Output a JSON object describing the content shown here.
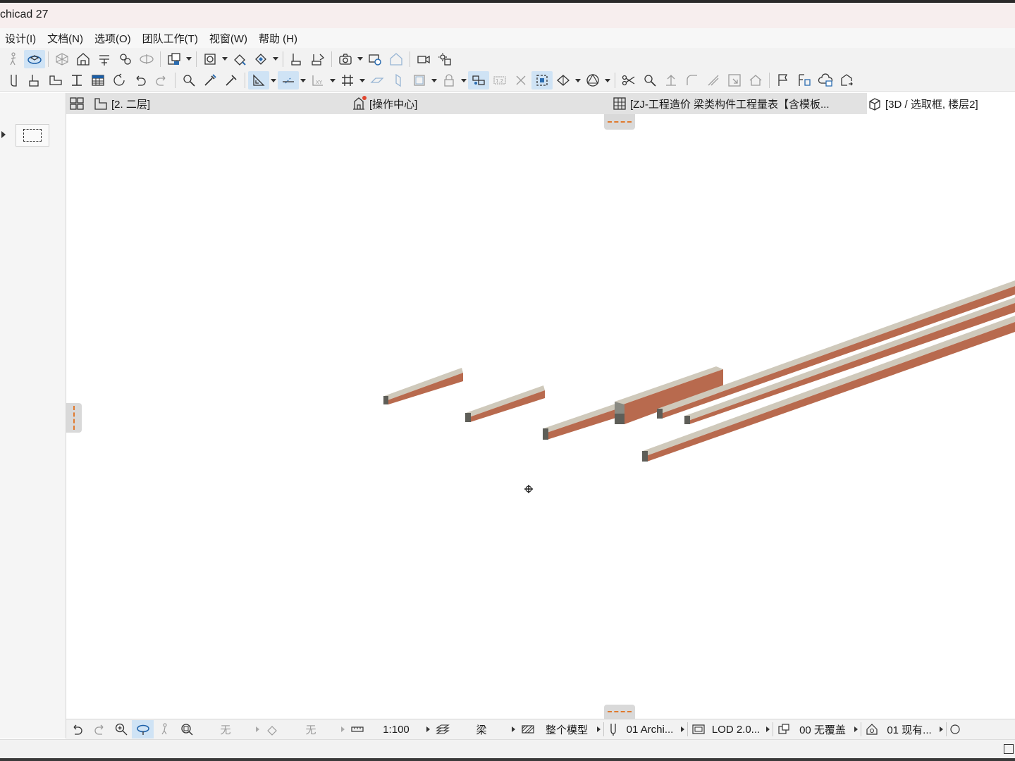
{
  "window": {
    "title": "chicad 27"
  },
  "menu": [
    "设计(I)",
    "文档(N)",
    "选项(O)",
    "团队工作(T)",
    "视窗(W)",
    "帮助 (H)"
  ],
  "tabs": [
    {
      "label": "[2. 二层]",
      "icon": "floor-plan-icon",
      "active": false
    },
    {
      "label": "[操作中心]",
      "icon": "action-center-icon",
      "active": false
    },
    {
      "label": "[ZJ-工程造价 梁类构件工程量表【含模板...",
      "icon": "schedule-table-icon",
      "active": false
    },
    {
      "label": "[3D / 选取框, 楼层2]",
      "icon": "3d-cube-icon",
      "active": true
    }
  ],
  "status": {
    "undo_label": "无",
    "redo_label": "无",
    "scale": "1:100",
    "element": "梁",
    "model_view": "整个模型",
    "pen_set": "01 Archi...",
    "lod": "LOD 2.0...",
    "override": "00 无覆盖",
    "renovation": "01 现有..."
  },
  "colors": {
    "beam_side": "#b86a4e",
    "beam_top": "#cfc9bb",
    "beam_end": "#5e5e58",
    "accent": "#e07a2e",
    "active_tab": "#ffffff"
  }
}
